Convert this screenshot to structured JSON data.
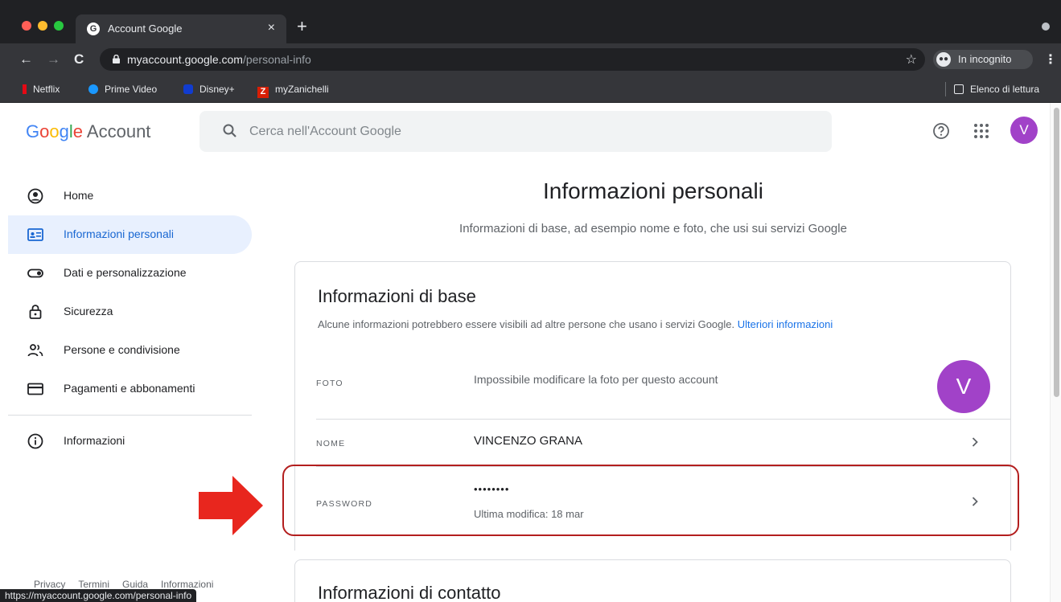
{
  "browser": {
    "tab_title": "Account Google",
    "tab_favicon": "G",
    "url_host": "myaccount.google.com",
    "url_path": "/personal-info",
    "incognito_label": "In incognito",
    "bookmarks": [
      "Netflix",
      "Prime Video",
      "Disney+",
      "myZanichelli"
    ],
    "reading_list": "Elenco di lettura",
    "status_url": "https://myaccount.google.com/personal-info"
  },
  "header": {
    "logo_google": [
      "G",
      "o",
      "o",
      "g",
      "l",
      "e"
    ],
    "logo_account": "Account",
    "search_placeholder": "Cerca nell'Account Google",
    "avatar_initial": "V"
  },
  "sidebar": {
    "items": [
      {
        "label": "Home",
        "icon": "account-circle-icon"
      },
      {
        "label": "Informazioni personali",
        "icon": "id-card-icon"
      },
      {
        "label": "Dati e personalizzazione",
        "icon": "toggle-icon"
      },
      {
        "label": "Sicurezza",
        "icon": "lock-icon"
      },
      {
        "label": "Persone e condivisione",
        "icon": "people-icon"
      },
      {
        "label": "Pagamenti e abbonamenti",
        "icon": "credit-card-icon"
      },
      {
        "label": "Informazioni",
        "icon": "info-icon"
      }
    ],
    "footer": [
      "Privacy",
      "Termini",
      "Guida",
      "Informazioni"
    ]
  },
  "main": {
    "title": "Informazioni personali",
    "subtitle": "Informazioni di base, ad esempio nome e foto, che usi sui servizi Google",
    "basic": {
      "title": "Informazioni di base",
      "desc": "Alcune informazioni potrebbero essere visibili ad altre persone che usano i servizi Google.",
      "link": "Ulteriori informazioni",
      "photo_label": "FOTO",
      "photo_value": "Impossibile modificare la foto per questo account",
      "photo_initial": "V",
      "name_label": "NOME",
      "name_value": "VINCENZO GRANA",
      "password_label": "PASSWORD",
      "password_value": "••••••••",
      "password_sub": "Ultima modifica: 18 mar"
    },
    "contact": {
      "title": "Informazioni di contatto"
    }
  },
  "colors": {
    "accent": "#1a73e8",
    "avatar": "#a142c8",
    "highlight": "#b31e1e",
    "arrow": "#e8261e"
  }
}
